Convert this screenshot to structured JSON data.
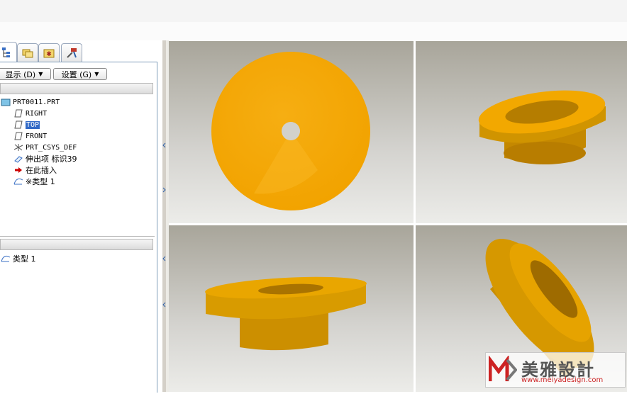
{
  "nav_tabs": [
    {
      "icon": "model-tree-icon"
    },
    {
      "icon": "folder-browser-icon"
    },
    {
      "icon": "favorites-icon"
    },
    {
      "icon": "connections-icon"
    }
  ],
  "toolbar": {
    "show_label": "显示 (D)",
    "settings_label": "设置 (G)"
  },
  "model_tree": {
    "items": [
      {
        "label": "PRT0011.PRT",
        "icon": "part-icon"
      },
      {
        "label": "RIGHT",
        "icon": "datum-plane-icon"
      },
      {
        "label": "TOP",
        "icon": "datum-plane-icon",
        "selected": true
      },
      {
        "label": "FRONT",
        "icon": "datum-plane-icon"
      },
      {
        "label": "PRT_CSYS_DEF",
        "icon": "csys-icon"
      },
      {
        "label": "伸出项 标识39",
        "icon": "extrude-icon"
      },
      {
        "label": "在此插入",
        "icon": "insert-here-arrow-icon"
      },
      {
        "label": "※类型 1",
        "icon": "sketch-type-icon"
      }
    ]
  },
  "layer_tree": {
    "items": [
      {
        "label": "类型 1",
        "icon": "sketch-type-icon"
      }
    ]
  },
  "colors": {
    "part_orange": "#f4a900",
    "part_dark": "#b87d00",
    "selection": "#3169c6",
    "panel_border": "#7f9db9"
  },
  "viewports": [
    {
      "view": "top"
    },
    {
      "view": "isometric-upper"
    },
    {
      "view": "front-lower"
    },
    {
      "view": "tilted"
    }
  ],
  "watermark": {
    "text": "美雅設計",
    "url": "www.meiyadesign.com"
  }
}
